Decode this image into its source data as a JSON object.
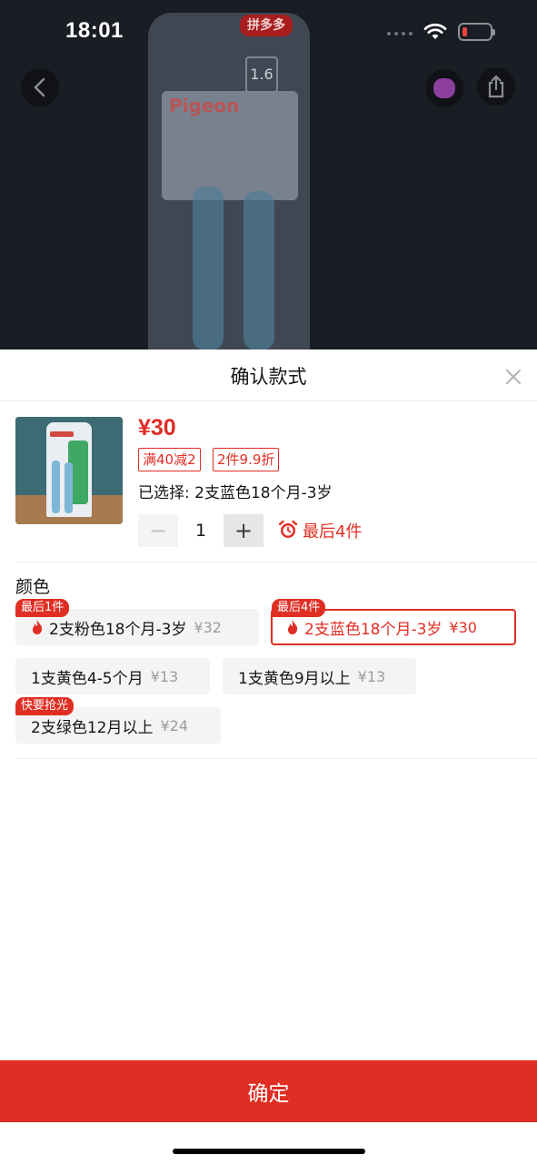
{
  "status_bar": {
    "time": "18:01"
  },
  "hero": {
    "brand_text": "Pigeon",
    "pdd_badge": "拼多多",
    "size_text": "1.6"
  },
  "sheet": {
    "title": "确认款式",
    "price": "¥30",
    "promotions": [
      "满40减2",
      "2件9.9折"
    ],
    "selected_text": "已选择: 2支蓝色18个月-3岁",
    "quantity": "1",
    "minus_symbol": "−",
    "plus_symbol": "+",
    "stock_hint": "最后4件",
    "color_label": "颜色",
    "options": [
      {
        "label": "2支粉色18个月-3岁",
        "price": "¥32",
        "tag": "最后1件"
      },
      {
        "label": "2支蓝色18个月-3岁",
        "price": "¥30",
        "tag": "最后4件"
      },
      {
        "label": "1支黄色4-5个月",
        "price": "¥13"
      },
      {
        "label": "1支黄色9月以上",
        "price": "¥13"
      },
      {
        "label": "2支绿色12月以上",
        "price": "¥24",
        "tag": "快要抢光"
      }
    ],
    "confirm_label": "确定"
  },
  "colors": {
    "accent": "#e02e24",
    "option_bg": "#f4f4f4"
  },
  "icons": [
    "back-icon",
    "share-icon",
    "close-icon",
    "alarm-icon",
    "fire-icon",
    "wifi-icon",
    "battery-icon"
  ]
}
